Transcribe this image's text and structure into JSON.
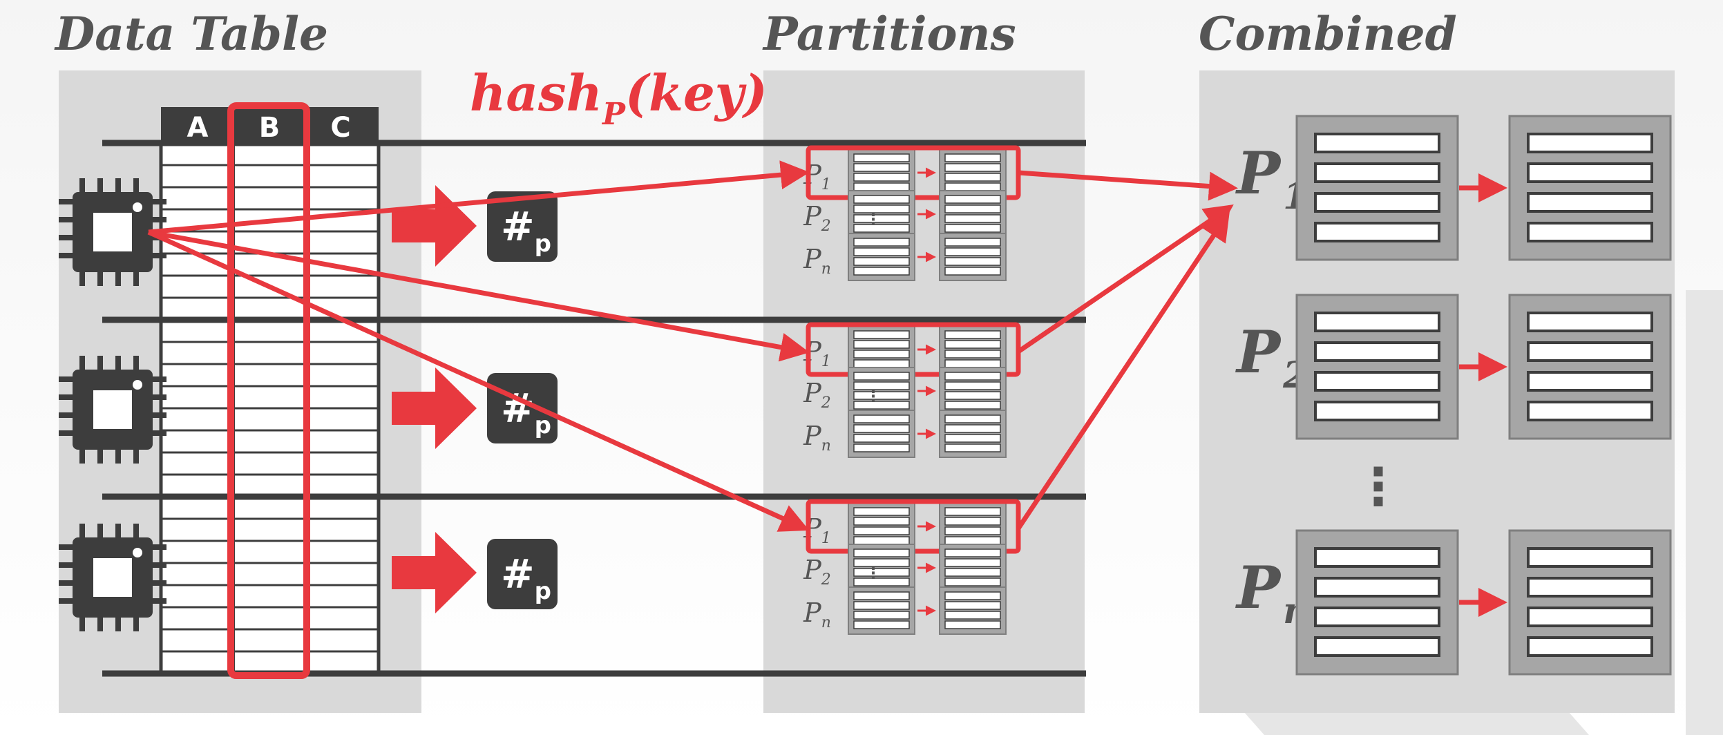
{
  "titles": {
    "data_table": "Data Table",
    "partitions": "Partitions",
    "combined": "Combined"
  },
  "hash_function": {
    "name": "hash",
    "subscript": "P",
    "argument": "(key)"
  },
  "columns": [
    "A",
    "B",
    "C"
  ],
  "highlighted_column": "B",
  "hash_box": {
    "symbol": "#",
    "subscript": "p"
  },
  "workers": [
    {
      "partitions": [
        {
          "label": "P",
          "sub": "1",
          "highlighted": true
        },
        {
          "label": "P",
          "sub": "2",
          "highlighted": false
        },
        {
          "label": "P",
          "sub": "n",
          "highlighted": false
        }
      ]
    },
    {
      "partitions": [
        {
          "label": "P",
          "sub": "1",
          "highlighted": true
        },
        {
          "label": "P",
          "sub": "2",
          "highlighted": false
        },
        {
          "label": "P",
          "sub": "n",
          "highlighted": false
        }
      ]
    },
    {
      "partitions": [
        {
          "label": "P",
          "sub": "1",
          "highlighted": true
        },
        {
          "label": "P",
          "sub": "2",
          "highlighted": false
        },
        {
          "label": "P",
          "sub": "n",
          "highlighted": false
        }
      ]
    }
  ],
  "combined": [
    {
      "label": "P",
      "sub": "1"
    },
    {
      "label": "P",
      "sub": "2"
    },
    {
      "label": "P",
      "sub": "n"
    }
  ],
  "ellipsis": "⋮",
  "colors": {
    "accent": "#e8393f",
    "dark": "#3d3d3d",
    "panel": "#d9d9d9",
    "block": "#a6a6a6",
    "text": "#555555"
  }
}
